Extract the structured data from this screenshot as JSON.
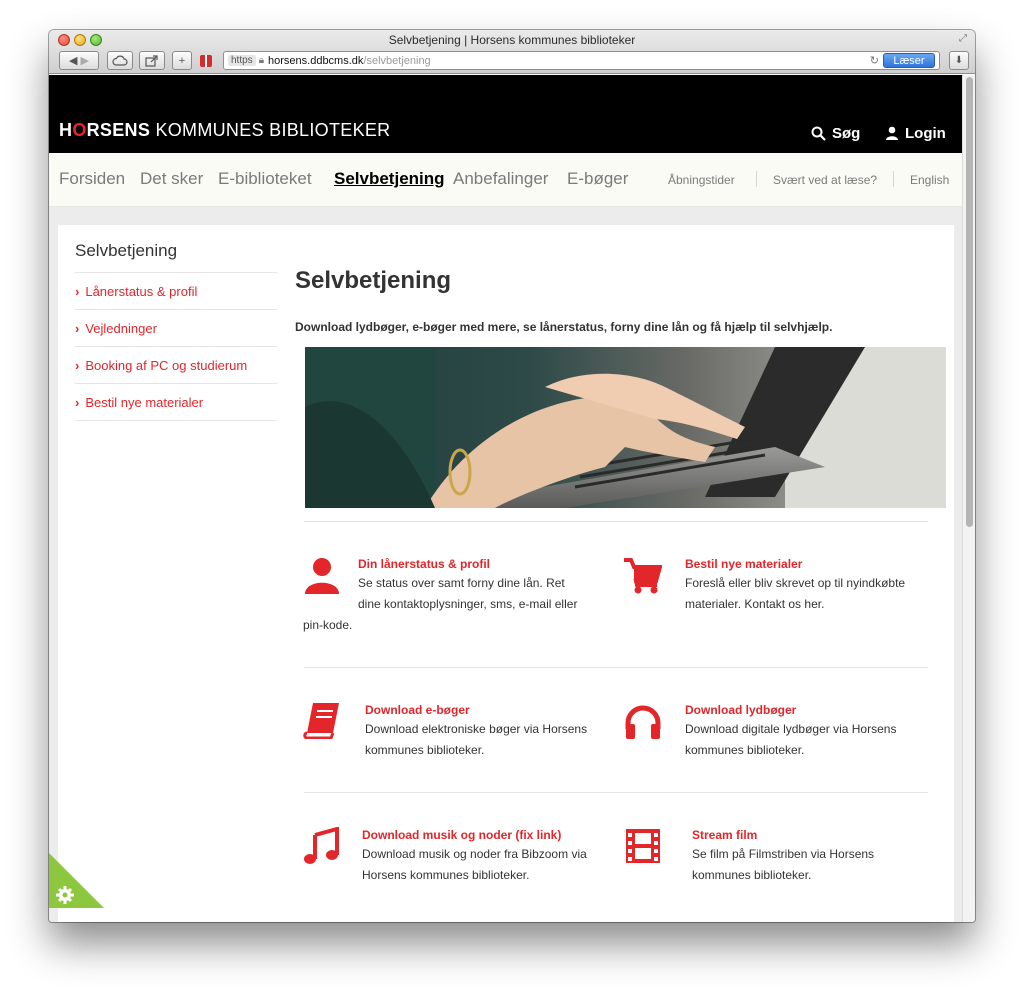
{
  "browser": {
    "window_title": "Selvbetjening | Horsens kommunes biblioteker",
    "url_scheme": "https",
    "url_domain": "horsens.ddbcms.dk",
    "url_path": "/selvbetjening",
    "reader_label": "Læser"
  },
  "header": {
    "logo_part1": "H",
    "logo_o": "O",
    "logo_part2": "RSENS",
    "logo_part3": " KOMMUNES BIBLIOTEKER",
    "search_label": "Søg",
    "login_label": "Login"
  },
  "mainnav": {
    "items": [
      "Forsiden",
      "Det sker",
      "E-biblioteket",
      "Selvbetjening",
      "Anbefalinger",
      "E-bøger"
    ],
    "util": [
      "Åbningstider",
      "Svært ved at læse?",
      "English"
    ]
  },
  "sidebar": {
    "title": "Selvbetjening",
    "items": [
      "Lånerstatus & profil",
      "Vejledninger",
      "Booking af PC og studierum",
      "Bestil nye materialer"
    ]
  },
  "main": {
    "title": "Selvbetjening",
    "lead": "Download lydbøger, e-bøger med mere, se lånerstatus, forny dine lån og få hjælp til selvhjælp.",
    "cards": [
      {
        "title": "Din lånerstatus & profil",
        "line1": "Se status over samt forny dine lån. Ret",
        "line2": "dine kontaktoplysninger, sms, e-mail eller",
        "line3": "pin-kode.",
        "icon": "user-icon"
      },
      {
        "title": "Bestil nye materialer",
        "line1": "Foreslå eller bliv skrevet op til nyindkøbte",
        "line2": "materialer. Kontakt os her.",
        "icon": "cart-icon"
      },
      {
        "title": "Download e-bøger",
        "line1": "Download elektroniske bøger via Horsens",
        "line2": "kommunes biblioteker.",
        "icon": "book-icon"
      },
      {
        "title": "Download lydbøger",
        "line1": "Download digitale lydbøger via Horsens",
        "line2": "kommunes biblioteker.",
        "icon": "headphones-icon"
      },
      {
        "title": "Download musik og noder (fix link)",
        "line1": "Download musik og noder fra Bibzoom via",
        "line2": "Horsens kommunes biblioteker.",
        "icon": "music-note-icon"
      },
      {
        "title": "Stream film",
        "line1": "Se film på Filmstriben via Horsens",
        "line2": "kommunes biblioteker.",
        "icon": "film-icon"
      }
    ]
  },
  "colors": {
    "accent": "#e3262a",
    "header_bg": "#000000",
    "nav_bg": "#fbfbf6"
  }
}
